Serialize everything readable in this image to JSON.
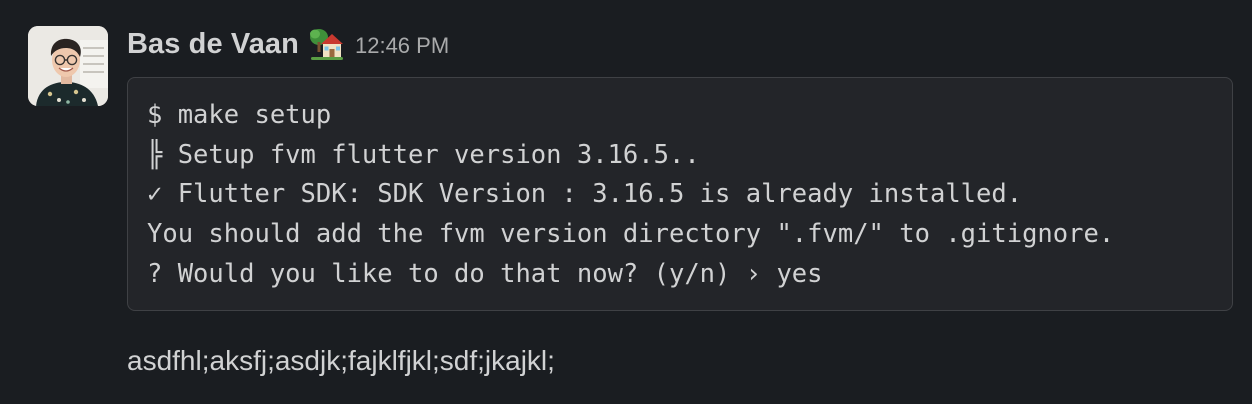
{
  "message": {
    "author": "Bas de Vaan",
    "status_emoji": "house-with-garden-icon",
    "timestamp": "12:46 PM",
    "code_lines": [
      "$ make setup",
      "╠ Setup fvm flutter version 3.16.5..",
      "✓ Flutter SDK: SDK Version : 3.16.5 is already installed.",
      "You should add the fvm version directory \".fvm/\" to .gitignore.",
      "? Would you like to do that now? (y/n) › yes"
    ],
    "text": "asdfhl;aksfj;asdjk;fajklfjkl;sdf;jkajkl;"
  },
  "colors": {
    "background": "#1a1d21",
    "text": "#d1d2d3",
    "muted": "#a9aaab",
    "code_background": "#232529",
    "code_border": "#3f4145"
  }
}
